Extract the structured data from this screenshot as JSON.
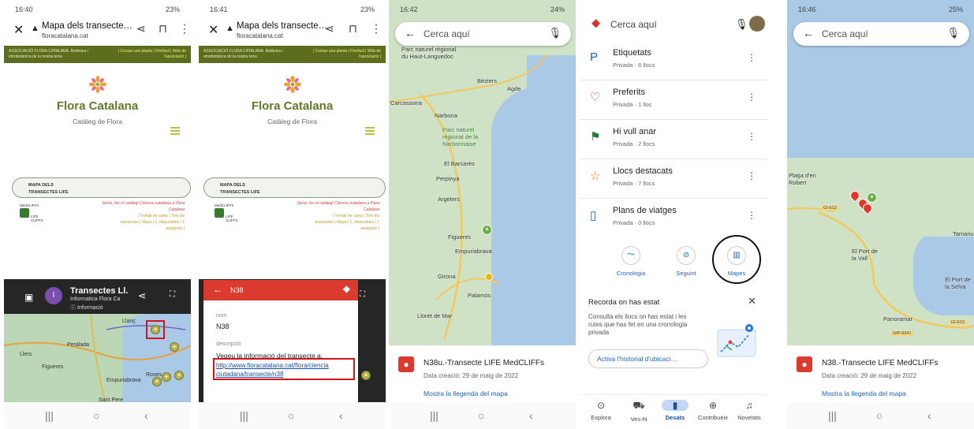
{
  "colors": {
    "accent_red": "#db3a2f",
    "link_blue": "#1a63c7",
    "flora_green": "#5f7a2a",
    "sea": "#aac9e6",
    "land": "#cfe2c6"
  },
  "icons": {
    "close": "close-icon",
    "share": "share-icon",
    "bookmark": "bookmark-icon",
    "more": "more-icon",
    "back": "back-arrow-icon",
    "mic": "mic-icon",
    "directions": "directions-icon",
    "walker": "hiker-icon",
    "pin": "map-pin-icon"
  },
  "p1": {
    "status_time": "16:40",
    "status_right": "23%",
    "browser_title": "Mapa dels transecte…",
    "browser_url": "floracatalana.cat",
    "banner_left": "ASSOCIACIÓ FLORA CATALANA. Botànica i etnobotànica de la nostra terra",
    "banner_right": "| Consar una planta | Florfàcil | Web de l'associació |",
    "site_title": "Flora Catalana",
    "site_subtitle": "Catàleg de Flora",
    "pill_line1": "MAPA DELS",
    "pill_line2": "TRANSECTES LIFE",
    "life_logo": "LIFE CLIFFS",
    "medcliffs": "MedCLIFFS",
    "links_red": "Seràs, fes el catàleg! Ciència ciutadana a Flora Catalana",
    "links_1": "| Treball de camp | Tots els",
    "links_2": "transectes | Mapa | 1, disponibles | 1",
    "links_3": "assignats |",
    "map_title": "Transectes Ll.",
    "map_author": "Informatica Flora Ca",
    "map_info": "Informació",
    "avatar": "I",
    "places": [
      "Llanç",
      "Peralada",
      "Llers",
      "Figueres",
      "Roses",
      "Empuriabrava",
      "Sant Pere"
    ]
  },
  "p2": {
    "status_time": "16:41",
    "status_right": "23%",
    "browser_title": "Mapa dels transecte…",
    "browser_url": "floracatalana.cat",
    "site_title": "Flora Catalana",
    "site_subtitle": "Catàleg de Flora",
    "pill_line1": "MAPA DELS",
    "pill_line2": "TRANSECTES LIFE",
    "panel_name": "N38",
    "label_nom": "nom",
    "value_nom": "N38",
    "label_desc": "descripció",
    "desc_text": "Vegeu la informació del transecte a:",
    "desc_link": "http://www.floracatalana.cat/flora/ciencia ciutadana/transecte/n38"
  },
  "p3": {
    "status_time": "16:42",
    "status_right": "24%",
    "search_placeholder": "Cerca aquí",
    "places": [
      "Parc naturel régional du Haut-Languedoc",
      "Béziers",
      "Agde",
      "Narbona",
      "Parc naturel régional de la Narbonnaise",
      "Carcassona",
      "El Barcarès",
      "Perpinyà",
      "Argelers",
      "Figueres",
      "Empuriabrava",
      "Girona",
      "Palamós",
      "Lloret de Mar"
    ],
    "result_title": "N38u.-Transecte LIFE MedCLIFFs",
    "result_date": "Data creació: 29 de maig de 2022",
    "legend_link": "Mostra la llegenda del mapa"
  },
  "p4": {
    "search_placeholder": "Cerca aquí",
    "lists": [
      {
        "name": "Etiquetats",
        "sub": "Privada · 6 llocs",
        "icon": "label-icon",
        "glyph": "P",
        "color": "#1a63c7"
      },
      {
        "name": "Preferits",
        "sub": "Privada · 1 lloc",
        "icon": "heart-icon",
        "glyph": "♡",
        "color": "#c2185b"
      },
      {
        "name": "Hi vull anar",
        "sub": "Privada · 2 llocs",
        "icon": "flag-icon",
        "glyph": "⚑",
        "color": "#188038"
      },
      {
        "name": "Llocs destacats",
        "sub": "Privada · 7 llocs",
        "icon": "star-icon",
        "glyph": "☆",
        "color": "#e37400"
      },
      {
        "name": "Plans de viatges",
        "sub": "Privada · 0 llocs",
        "icon": "suitcase-icon",
        "glyph": "▯",
        "color": "#1a63c7"
      }
    ],
    "quick": [
      {
        "label": "Cronologia",
        "glyph": "〜"
      },
      {
        "label": "Seguint",
        "glyph": "⊘"
      },
      {
        "label": "Mapes",
        "glyph": "▥"
      }
    ],
    "recorda_title": "Recorda on has estat",
    "recorda_text": "Consulta els llocs on has estat i les rutes que has fet en una cronologia privada",
    "recorda_button": "Activa l'historial d'ubicaci…",
    "tabs": [
      {
        "label": "Explora",
        "glyph": "⊙"
      },
      {
        "label": "Ves-hi",
        "glyph": "⛟"
      },
      {
        "label": "Desats",
        "glyph": "▮"
      },
      {
        "label": "Contribueix",
        "glyph": "⊕"
      },
      {
        "label": "Novetats",
        "glyph": "♫"
      }
    ]
  },
  "p5": {
    "status_time": "16:46",
    "status_right": "25%",
    "search_placeholder": "Cerca aquí",
    "places": [
      "Platja d'en Robert",
      "Tamariu",
      "El Port de la Vall",
      "El Port de la Selva",
      "Panoramar",
      "GI-612",
      "GI-613",
      "GIP-6041"
    ],
    "result_title": "N38.-Transecte LIFE MedCLIFFs",
    "result_date": "Data creació: 29 de maig de 2022",
    "legend_link": "Mostra la llegenda del mapa"
  },
  "nav": {
    "recent": "|||",
    "home": "○",
    "back": "‹"
  }
}
